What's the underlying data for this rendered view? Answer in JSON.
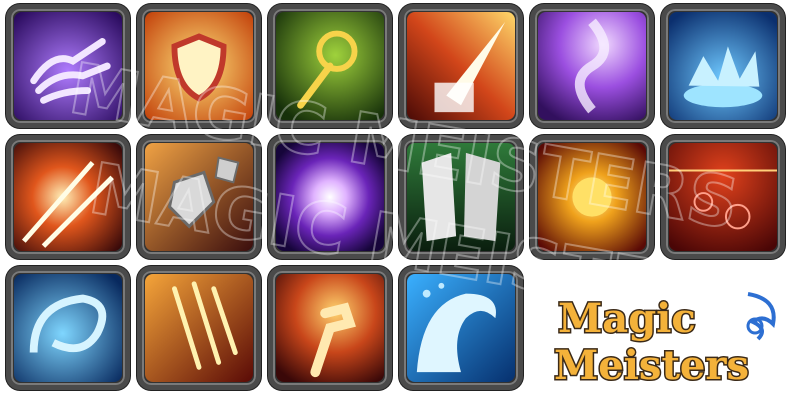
{
  "logo": {
    "line1": "Magic",
    "line2": "Meisters"
  },
  "watermark": {
    "text": "MAGIC MEISTERS"
  },
  "icons": [
    {
      "id": "skeletal-hand",
      "icon": "skeletal-hand-icon"
    },
    {
      "id": "golden-shield",
      "icon": "golden-shield-icon"
    },
    {
      "id": "sun-staff",
      "icon": "sun-staff-icon"
    },
    {
      "id": "light-beam",
      "icon": "light-beam-icon"
    },
    {
      "id": "purple-smoke",
      "icon": "purple-smoke-icon"
    },
    {
      "id": "water-splash",
      "icon": "water-splash-icon"
    },
    {
      "id": "light-slash",
      "icon": "light-slash-icon"
    },
    {
      "id": "stone-shards",
      "icon": "stone-shards-icon"
    },
    {
      "id": "void-orb",
      "icon": "void-orb-icon"
    },
    {
      "id": "stone-walls",
      "icon": "stone-walls-icon"
    },
    {
      "id": "fire-burst",
      "icon": "fire-burst-icon"
    },
    {
      "id": "blood-bubbles",
      "icon": "blood-bubbles-icon"
    },
    {
      "id": "water-vortex",
      "icon": "water-vortex-icon"
    },
    {
      "id": "flame-claws",
      "icon": "flame-claws-icon"
    },
    {
      "id": "fire-fist",
      "icon": "fire-fist-icon"
    },
    {
      "id": "tidal-wave",
      "icon": "tidal-wave-icon"
    }
  ],
  "colors": {
    "frame": "#4a4a4a",
    "logo_fill": "#f4b23a",
    "logo_accent": "#2d6fd2"
  }
}
